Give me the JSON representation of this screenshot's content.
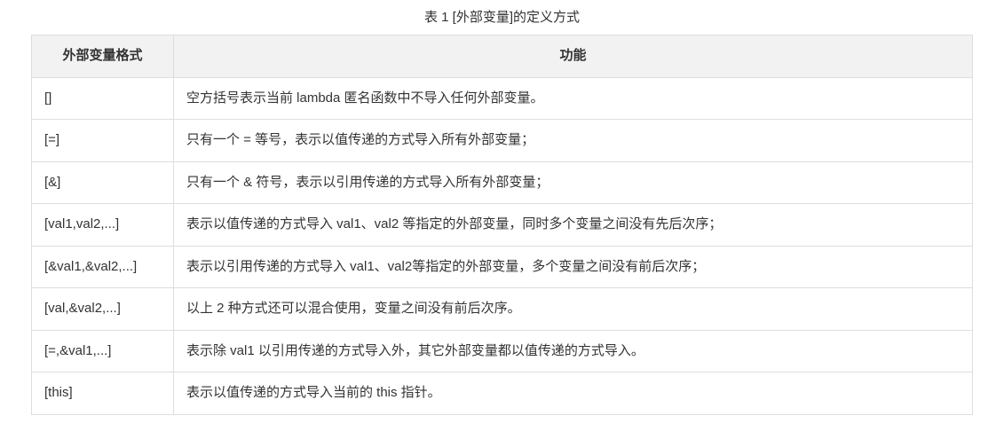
{
  "caption": "表 1 [外部变量]的定义方式",
  "headers": {
    "col1": "外部变量格式",
    "col2": "功能"
  },
  "rows": [
    {
      "format": "[]",
      "desc": "空方括号表示当前 lambda 匿名函数中不导入任何外部变量。"
    },
    {
      "format": "[=]",
      "desc": "只有一个 = 等号，表示以值传递的方式导入所有外部变量；"
    },
    {
      "format": "[&]",
      "desc": "只有一个 & 符号，表示以引用传递的方式导入所有外部变量；"
    },
    {
      "format": "[val1,val2,...]",
      "desc": "表示以值传递的方式导入 val1、val2 等指定的外部变量，同时多个变量之间没有先后次序；"
    },
    {
      "format": "[&val1,&val2,...]",
      "desc": "表示以引用传递的方式导入 val1、val2等指定的外部变量，多个变量之间没有前后次序；"
    },
    {
      "format": "[val,&val2,...]",
      "desc": "以上 2 种方式还可以混合使用，变量之间没有前后次序。"
    },
    {
      "format": "[=,&val1,...]",
      "desc": "表示除 val1 以引用传递的方式导入外，其它外部变量都以值传递的方式导入。"
    },
    {
      "format": "[this]",
      "desc": "表示以值传递的方式导入当前的 this 指针。"
    }
  ]
}
